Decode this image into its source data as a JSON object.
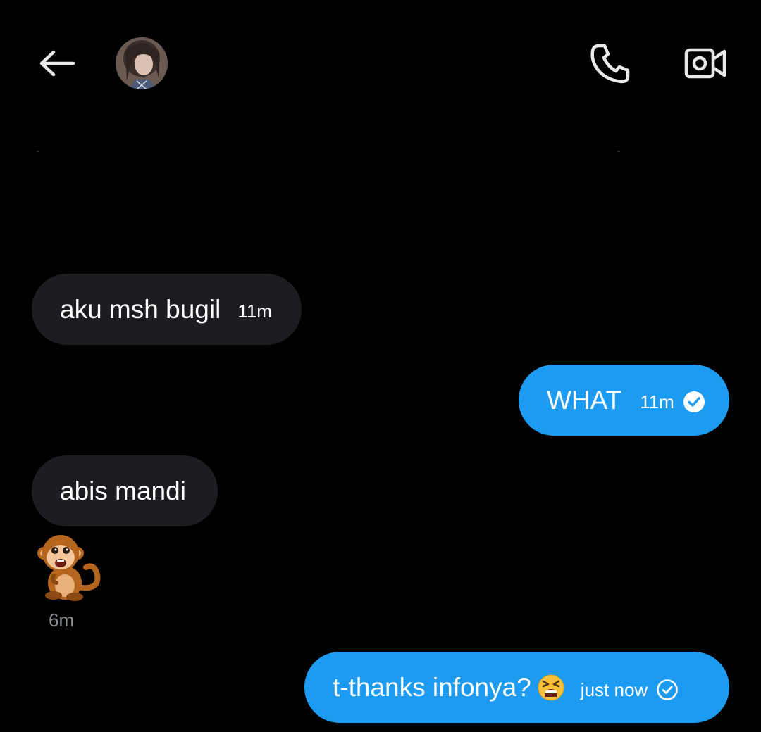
{
  "header": {
    "back_icon": "arrow-left-icon",
    "avatar_icon": "contact-avatar",
    "call_icon": "phone-icon",
    "video_icon": "video-camera-icon"
  },
  "messages": [
    {
      "direction": "incoming",
      "text": "aku msh bugil",
      "time": "11m"
    },
    {
      "direction": "outgoing",
      "text": "WHAT",
      "time": "11m",
      "status_icon": "read-check-filled-icon"
    },
    {
      "direction": "incoming",
      "text": "abis mandi",
      "time": ""
    },
    {
      "direction": "incoming",
      "sticker": "monkey-emoji-icon",
      "time": "6m"
    },
    {
      "direction": "outgoing",
      "text": "t-thanks infonya?",
      "emoji": "tired-face-emoji-icon",
      "time": "just now",
      "status_icon": "sent-check-outline-icon"
    }
  ],
  "colors": {
    "background": "#000000",
    "incoming_bubble": "#1c1d20",
    "outgoing_bubble": "#1d9bf0",
    "muted_text": "#8b8f94"
  }
}
